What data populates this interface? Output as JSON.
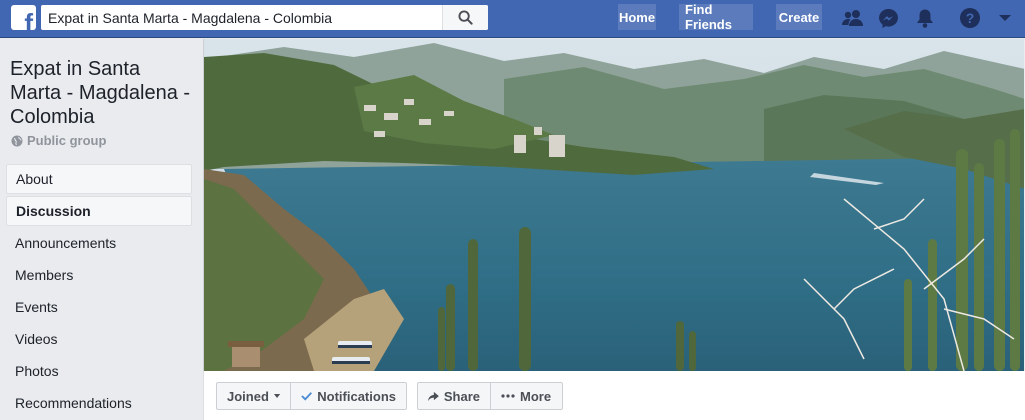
{
  "topbar": {
    "logo_letter": "f",
    "search_value": "Expat in Santa Marta - Magdalena - Colombia",
    "nav": {
      "home": "Home",
      "find_friends": "Find Friends",
      "create": "Create"
    },
    "icons": [
      "friend-requests-icon",
      "messenger-icon",
      "notifications-icon",
      "help-icon",
      "account-menu-icon"
    ]
  },
  "group": {
    "name": "Expat in Santa Marta - Magdalena - Colombia",
    "privacy": "Public group"
  },
  "sidebar": {
    "items": [
      {
        "label": "About"
      },
      {
        "label": "Discussion"
      },
      {
        "label": "Announcements"
      },
      {
        "label": "Members"
      },
      {
        "label": "Events"
      },
      {
        "label": "Videos"
      },
      {
        "label": "Photos"
      },
      {
        "label": "Recommendations"
      }
    ]
  },
  "actions": {
    "joined": "Joined",
    "notifications": "Notifications",
    "share": "Share",
    "more": "More"
  },
  "colors": {
    "brand": "#4267b2",
    "accent": "#3578e5"
  }
}
